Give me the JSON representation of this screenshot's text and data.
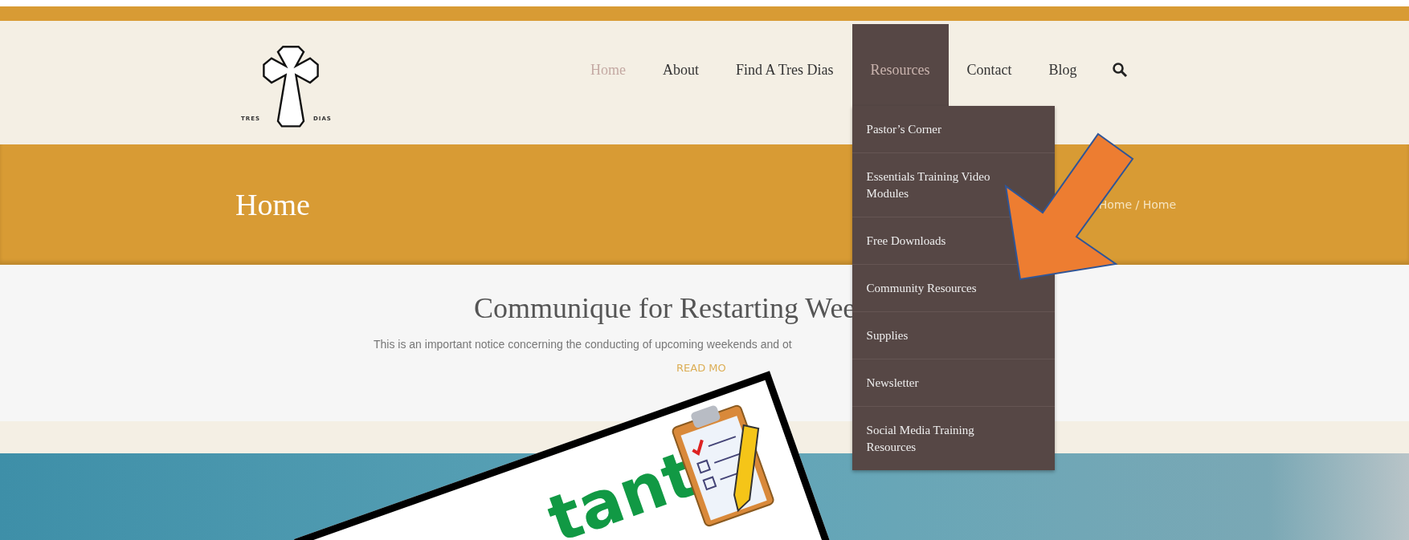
{
  "logo": {
    "left_text": "TRES",
    "right_text": "DIAS"
  },
  "nav": {
    "items": [
      {
        "label": "Home",
        "selected": true,
        "open": false
      },
      {
        "label": "About",
        "selected": false,
        "open": false
      },
      {
        "label": "Find A Tres Dias",
        "selected": false,
        "open": false
      },
      {
        "label": "Resources",
        "selected": false,
        "open": true
      },
      {
        "label": "Contact",
        "selected": false,
        "open": false
      },
      {
        "label": "Blog",
        "selected": false,
        "open": false
      }
    ]
  },
  "dropdown": {
    "items": [
      "Pastor’s Corner",
      "Essentials Training Video Modules",
      "Free Downloads",
      "Community Resources",
      "Supplies",
      "Newsletter",
      "Social Media Training Resources"
    ]
  },
  "banner": {
    "title": "Home",
    "breadcrumb": "Home / Home"
  },
  "post": {
    "title": "Communique for Restarting Wee",
    "excerpt": "This is an important notice concerning the conducting of upcoming weekends and ot",
    "read_more": "READ MO"
  },
  "sign": {
    "text": "tant"
  }
}
